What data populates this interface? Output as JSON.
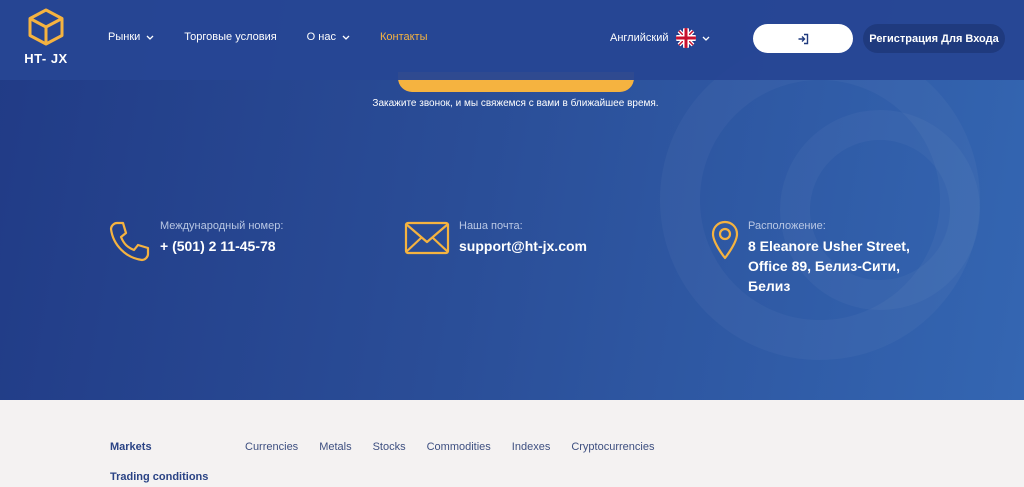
{
  "header": {
    "logo_text": "HT- JX",
    "nav": [
      {
        "label": "Рынки"
      },
      {
        "label": "Торговые условия"
      },
      {
        "label": "О нас"
      },
      {
        "label": "Контакты"
      }
    ],
    "language": "Английский",
    "register_label": "Регистрация Для Входа"
  },
  "cta": {
    "text": "Закажите звонок, и мы свяжемся с вами в ближайшее время."
  },
  "contacts": {
    "phone": {
      "label": "Международный номер:",
      "value": "+ (501) 2 11-45-78"
    },
    "email": {
      "label": "Наша почта:",
      "value": "support@ht-jx.com"
    },
    "location": {
      "label": "Расположение:",
      "line1": "8 Eleanore Usher Street,",
      "line2": "Office 89, Белиз-Сити,",
      "line3": "Белиз"
    }
  },
  "footer": {
    "markets_title": "Markets",
    "markets_links": [
      "Currencies",
      "Metals",
      "Stocks",
      "Commodities",
      "Indexes",
      "Cryptocurrencies"
    ],
    "trading_title": "Trading conditions"
  },
  "colors": {
    "accent": "#f5b340",
    "hero_dark": "#213b86",
    "hero_light": "#3466b2",
    "register_button": "#1f3a7e"
  }
}
